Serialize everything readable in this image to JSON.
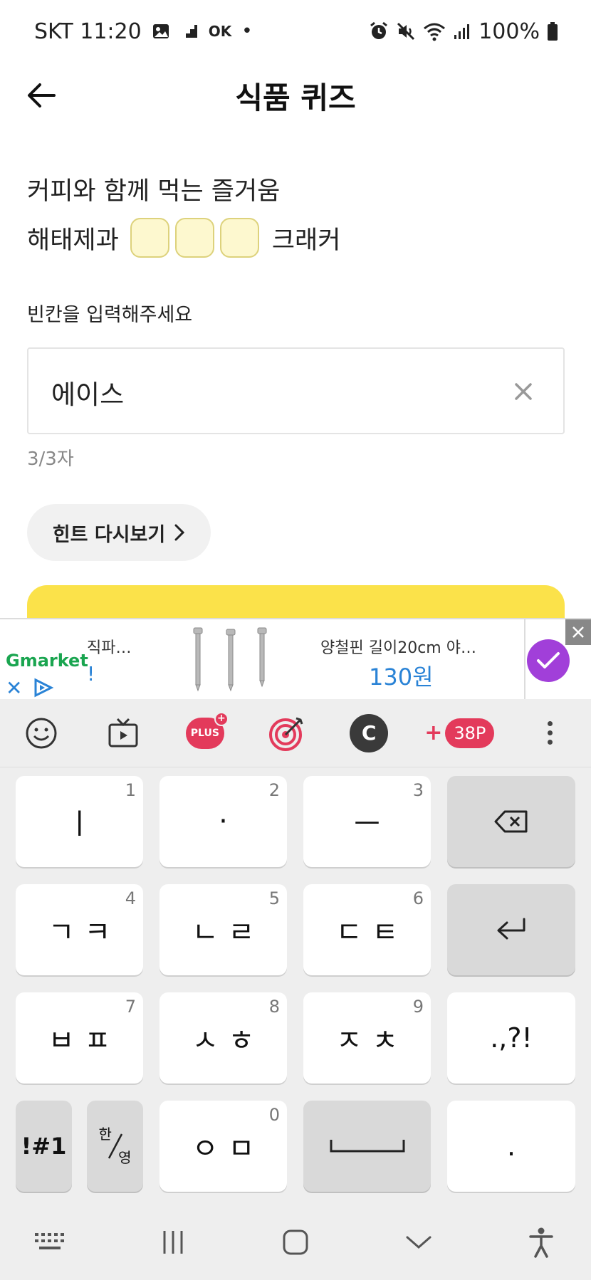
{
  "status_bar": {
    "carrier_time": "SKT 11:20",
    "ok_label": "OK",
    "battery": "100%"
  },
  "header": {
    "title": "식품 퀴즈"
  },
  "quiz": {
    "question": "커피와 함께 먹는 즐거움",
    "answer_prefix": "해태제과",
    "answer_suffix": "크래커",
    "blank_count": 3,
    "instruction": "빈칸을 입력해주세요",
    "input_value": "에이스",
    "char_count": "3/3자",
    "hint_label": "힌트 다시보기"
  },
  "ad": {
    "brand": "Gmarket",
    "left_text": "직파…",
    "left_text2": "!",
    "title": "양철핀 길이20cm 야…",
    "price": "130원"
  },
  "keyboard": {
    "points": "38P",
    "plus_badge": "PLUS",
    "c_badge": "C",
    "keys": [
      {
        "label": "ㅣ",
        "num": "1"
      },
      {
        "label": "·",
        "num": "2"
      },
      {
        "label": "ㅡ",
        "num": "3"
      },
      {
        "label": "ㄱㅋ",
        "num": "4"
      },
      {
        "label": "ㄴㄹ",
        "num": "5"
      },
      {
        "label": "ㄷㅌ",
        "num": "6"
      },
      {
        "label": "ㅂㅍ",
        "num": "7"
      },
      {
        "label": "ㅅㅎ",
        "num": "8"
      },
      {
        "label": "ㅈㅊ",
        "num": "9"
      },
      {
        "label": ".,?!"
      },
      {
        "label": "!#1"
      },
      {
        "label": "ㅇㅁ",
        "num": "0"
      },
      {
        "label": "."
      }
    ],
    "lang_top": "한",
    "lang_bottom": "영"
  },
  "colors": {
    "accent_yellow": "#fbe24a",
    "blank_fill": "#fdf8cf",
    "ad_check": "#a13fd9",
    "keyboard_pink": "#e33a5b"
  }
}
